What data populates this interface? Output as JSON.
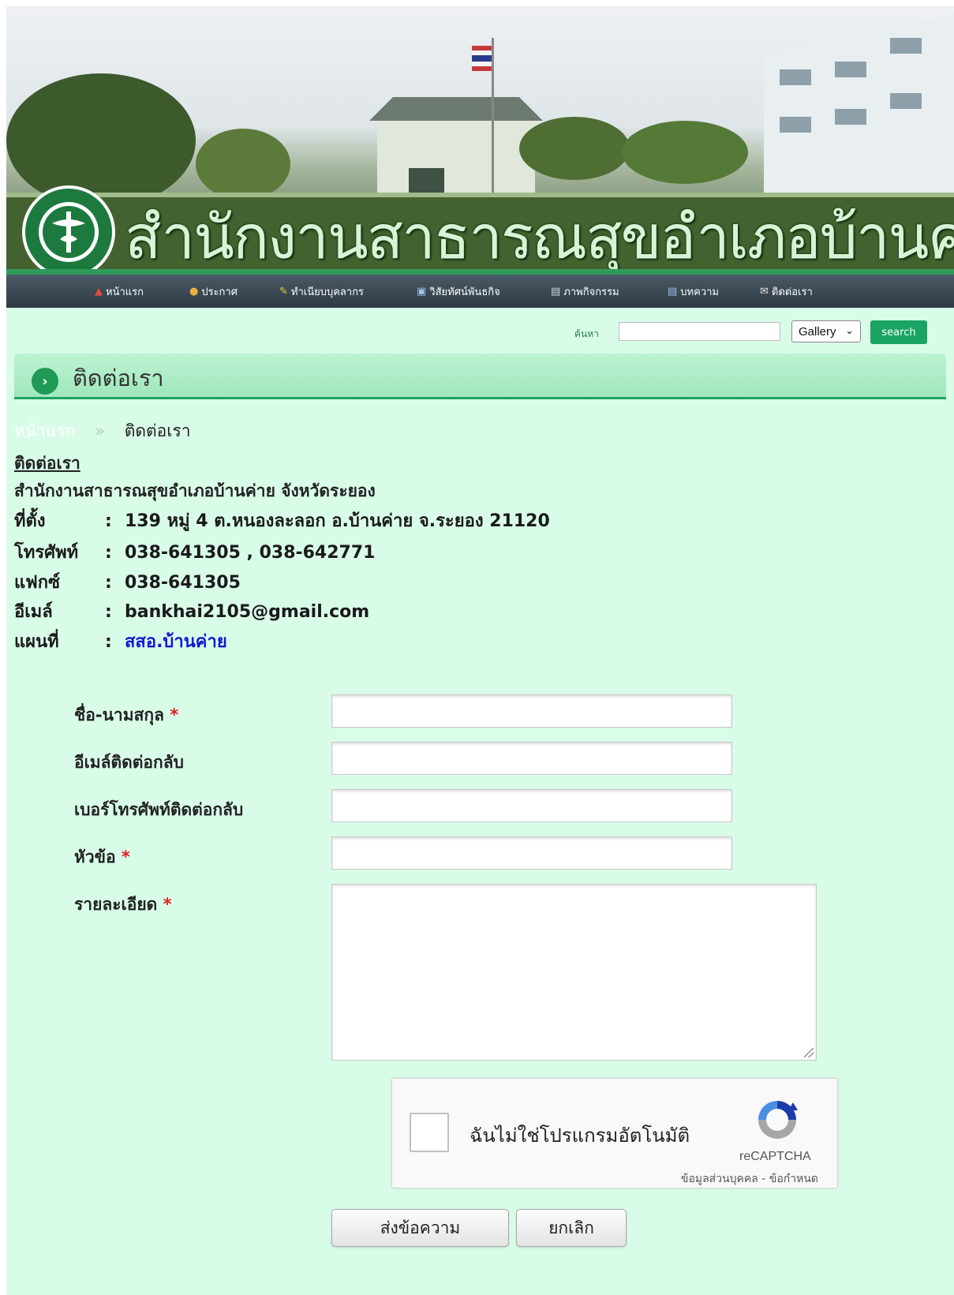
{
  "header": {
    "site_title": "สำนักงานสาธารณสุขอำเภอบ้านค่าย"
  },
  "nav": {
    "items": [
      {
        "label": "หน้าแรก",
        "icon": "home-icon"
      },
      {
        "label": "ประกาศ",
        "icon": "announce-icon"
      },
      {
        "label": "ทำเนียบบุคลากร",
        "icon": "staff-icon"
      },
      {
        "label": "วิสัยทัศน์พันธกิจ",
        "icon": "vision-icon"
      },
      {
        "label": "ภาพกิจกรรม",
        "icon": "gallery-icon"
      },
      {
        "label": "บทความ",
        "icon": "article-icon"
      },
      {
        "label": "ติดต่อเรา",
        "icon": "contact-icon"
      }
    ]
  },
  "search": {
    "label": "ค้นหา",
    "input_value": "",
    "category": "Gallery",
    "button": "search"
  },
  "section": {
    "title": "ติดต่อเรา"
  },
  "breadcrumb": {
    "home": "หน้าแรก",
    "separator": "»",
    "current": "ติดต่อเรา"
  },
  "contact": {
    "heading": "ติดต่อเรา",
    "org_name": "สำนักงานสาธารณสุขอำเภอบ้านค่าย จังหวัดระยอง",
    "rows": [
      {
        "label": "ที่ตั้ง",
        "value": "139 หมู่ 4 ต.หนองละลอก อ.บ้านค่าย จ.ระยอง 21120"
      },
      {
        "label": "โทรศัพท์",
        "value": "038-641305 , 038-642771"
      },
      {
        "label": "แฟกซ์",
        "value": "038-641305"
      },
      {
        "label": "อีเมล์",
        "value": "bankhai2105@gmail.com"
      },
      {
        "label": "แผนที่",
        "value": "สสอ.บ้านค่าย"
      }
    ],
    "colon": ":"
  },
  "form": {
    "name_label": "ชื่อ-นามสกุล",
    "email_label": "อีเมล์ติดต่อกลับ",
    "phone_label": "เบอร์โทรศัพท์ติดต่อกลับ",
    "subject_label": "หัวข้อ",
    "detail_label": "รายละเอียด",
    "required_mark": "*",
    "submit": "ส่งข้อความ",
    "cancel": "ยกเลิก"
  },
  "recaptcha": {
    "label": "ฉันไม่ใช่โปรแกรมอัตโนมัติ",
    "brand": "reCAPTCHA",
    "terms": "ข้อมูลส่วนบุคคล - ข้อกำหนด"
  },
  "colors": {
    "page_bg": "#d9fce9",
    "accent_green": "#1aa463",
    "nav_bg": "#2c3a44",
    "link_blue": "#1515d4",
    "required_red": "#e02020"
  }
}
